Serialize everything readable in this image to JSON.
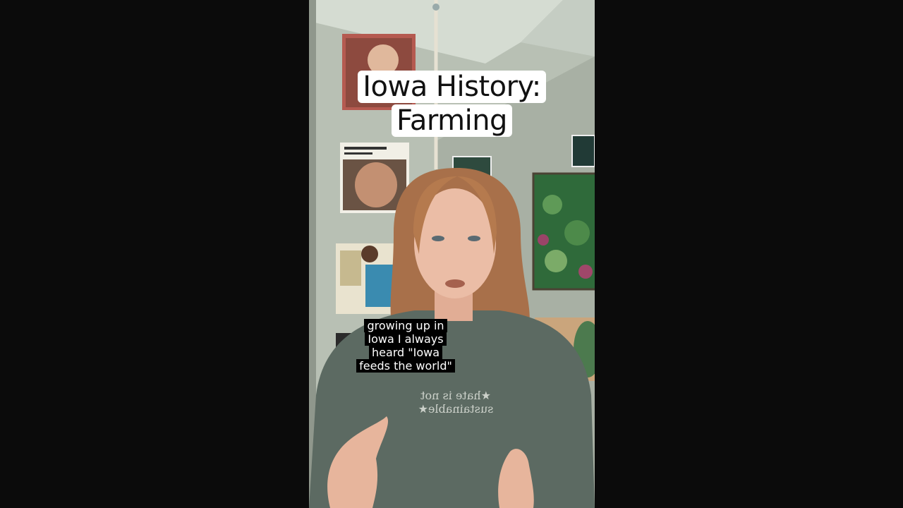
{
  "video": {
    "title_line_1": "Iowa History:",
    "title_line_2": "Farming",
    "caption_lines": [
      "growing up in",
      "Iowa I always",
      "heard \"Iowa",
      "feeds the world\""
    ],
    "shirt_text": "★hate is not sustainable★"
  },
  "colors": {
    "letterbox": "#0b0b0b",
    "wall": "#b9c1b5",
    "shirt": "#5f6b63",
    "hair": "#b57a4e",
    "skin": "#e8b9a2"
  }
}
